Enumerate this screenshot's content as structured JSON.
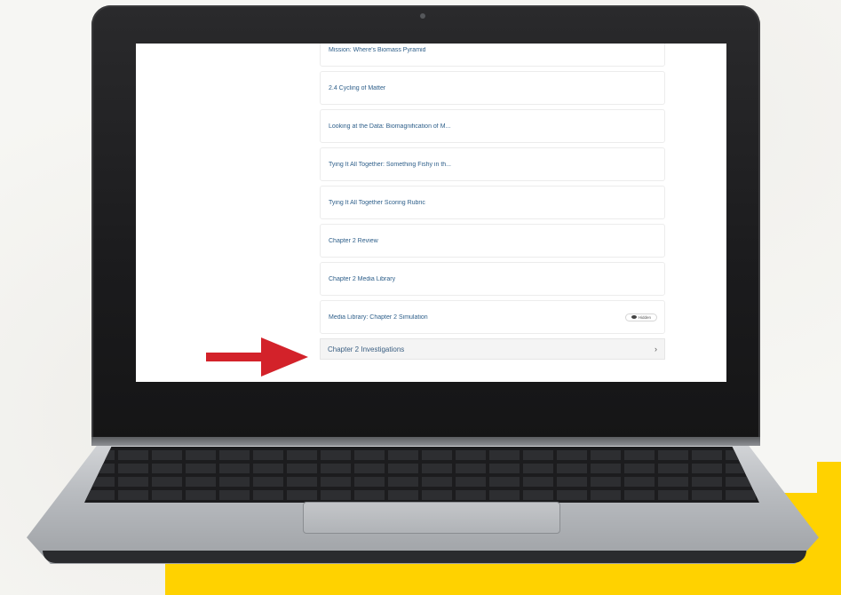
{
  "lesson_items": [
    {
      "label": "Mission: Where's Biomass Pyramid"
    },
    {
      "label": "2.4 Cycling of Matter"
    },
    {
      "label": "Looking at the Data: Biomagnification of M..."
    },
    {
      "label": "Tying It All Together: Something Fishy in th..."
    },
    {
      "label": "Tying It All Together Scoring Rubric"
    },
    {
      "label": "Chapter 2 Review"
    },
    {
      "label": "Chapter 2 Media Library"
    },
    {
      "label": "Media Library: Chapter 2 Simulation",
      "badge": "Hidden"
    }
  ],
  "section": {
    "label": "Chapter 2 Investigations",
    "chevron": "›"
  },
  "colors": {
    "link": "#2e5f8a",
    "arrow": "#d3222a",
    "accent_yellow": "#ffd200"
  },
  "icons": {
    "badge_icon": "eye-icon",
    "section_icon": "chevron-right-icon",
    "pointer": "red-arrow-icon"
  }
}
